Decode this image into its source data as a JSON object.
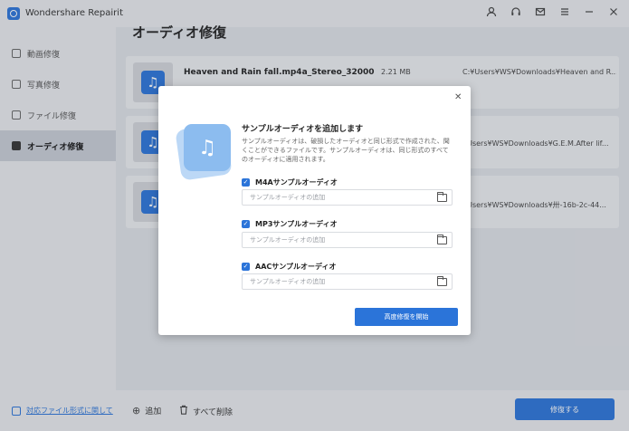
{
  "app": {
    "title": "Wondershare Repairit"
  },
  "sidebar": {
    "items": [
      {
        "label": "動画修復"
      },
      {
        "label": "写真修復"
      },
      {
        "label": "ファイル修復"
      },
      {
        "label": "オーディオ修復"
      }
    ],
    "active_index": 3,
    "bottom_link": "対応ファイル形式に関して"
  },
  "main": {
    "title": "オーディオ修復",
    "files": [
      {
        "name": "Heaven and Rain fall.mp4a_Stereo_32000",
        "size": "2.21 MB",
        "path": "C:¥Users¥WS¥Downloads¥Heaven and R..."
      },
      {
        "name": "",
        "size": "",
        "path": "¥Users¥WS¥Downloads¥G.E.M.After lif..."
      },
      {
        "name": "",
        "size": "",
        "path": "¥Users¥WS¥Downloads¥卅-16b-2c-44..."
      }
    ]
  },
  "bottombar": {
    "add_label": "追加",
    "delete_all_label": "すべて削除",
    "repair_label": "修復する"
  },
  "modal": {
    "heading": "サンプルオーディオを追加します",
    "description": "サンプルオーディオは、破損したオーディオと同じ形式で作成された、聞くことができるファイルです。サンプルオーディオは、同じ形式のすべてのオーディオに適用されます。",
    "options": [
      {
        "label": "M4Aサンプルオーディオ",
        "checked": true,
        "placeholder": "サンプルオーディオの追加"
      },
      {
        "label": "MP3サンプルオーディオ",
        "checked": true,
        "placeholder": "サンプルオーディオの追加"
      },
      {
        "label": "AACサンプルオーディオ",
        "checked": true,
        "placeholder": "サンプルオーディオの追加"
      }
    ],
    "start_button": "高度修復を開始",
    "close_glyph": "✕"
  },
  "icons": {
    "user": "user-icon",
    "headset": "headset-icon",
    "mail": "mail-icon",
    "menu": "menu-icon",
    "minimize": "minimize-icon",
    "close": "close-icon"
  },
  "colors": {
    "accent": "#2b74d9"
  }
}
